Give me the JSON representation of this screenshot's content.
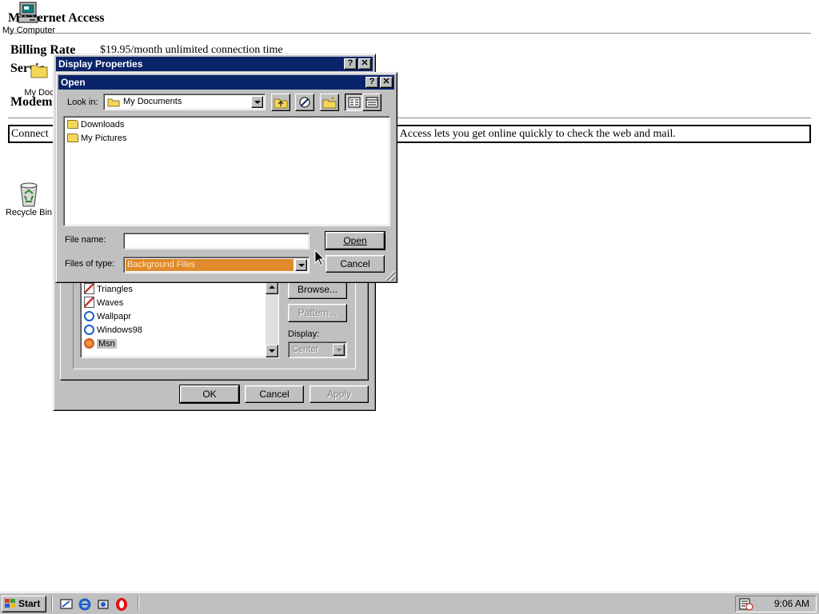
{
  "web_page": {
    "title": "M Internet Access",
    "title_prefix": "M",
    "title_rest": "Internet Access",
    "billing_label": "Billing Rate",
    "billing_value": "$19.95/month unlimited connection time",
    "service_label": "Servic",
    "modem_label": "Modem",
    "connect_box_start": "Connect",
    "connect_box_end": "t Access lets you get online quickly to check the web and mail."
  },
  "desktop": {
    "icons": [
      {
        "label": "My Computer",
        "icon": "my-computer-icon"
      },
      {
        "label": "My Doc",
        "icon": "my-documents-icon"
      },
      {
        "label": "Recycle Bin",
        "icon": "recycle-bin-icon"
      }
    ]
  },
  "display_properties": {
    "title": "Display Properties",
    "wallpaper_list": [
      {
        "name": "Triangles",
        "icon": "bitmap-icon"
      },
      {
        "name": "Waves",
        "icon": "bitmap-icon"
      },
      {
        "name": "Wallpapr",
        "icon": "html-icon"
      },
      {
        "name": "Windows98",
        "icon": "html-icon"
      },
      {
        "name": "Msn",
        "icon": "msn-icon",
        "selected": true
      }
    ],
    "browse_label": "Browse...",
    "pattern_label": "Pattern...",
    "display_label": "Display:",
    "display_value": "Center",
    "ok_label": "OK",
    "cancel_label": "Cancel",
    "apply_label": "Apply"
  },
  "open_dialog": {
    "title": "Open",
    "look_in_label": "Look in:",
    "look_in_value": "My Documents",
    "files": [
      {
        "name": "Downloads",
        "icon": "folder-icon"
      },
      {
        "name": "My Pictures",
        "icon": "folder-icon"
      }
    ],
    "file_name_label": "File name:",
    "file_name_value": "",
    "files_of_type_label": "Files of type:",
    "files_of_type_value": "Background Files",
    "open_label": "Open",
    "cancel_label": "Cancel"
  },
  "taskbar": {
    "start_label": "Start",
    "clock": "9:06 AM"
  },
  "colors": {
    "title_active": "#0a246a",
    "face": "#c0c0c0",
    "highlight_field": "#e08a2c"
  }
}
